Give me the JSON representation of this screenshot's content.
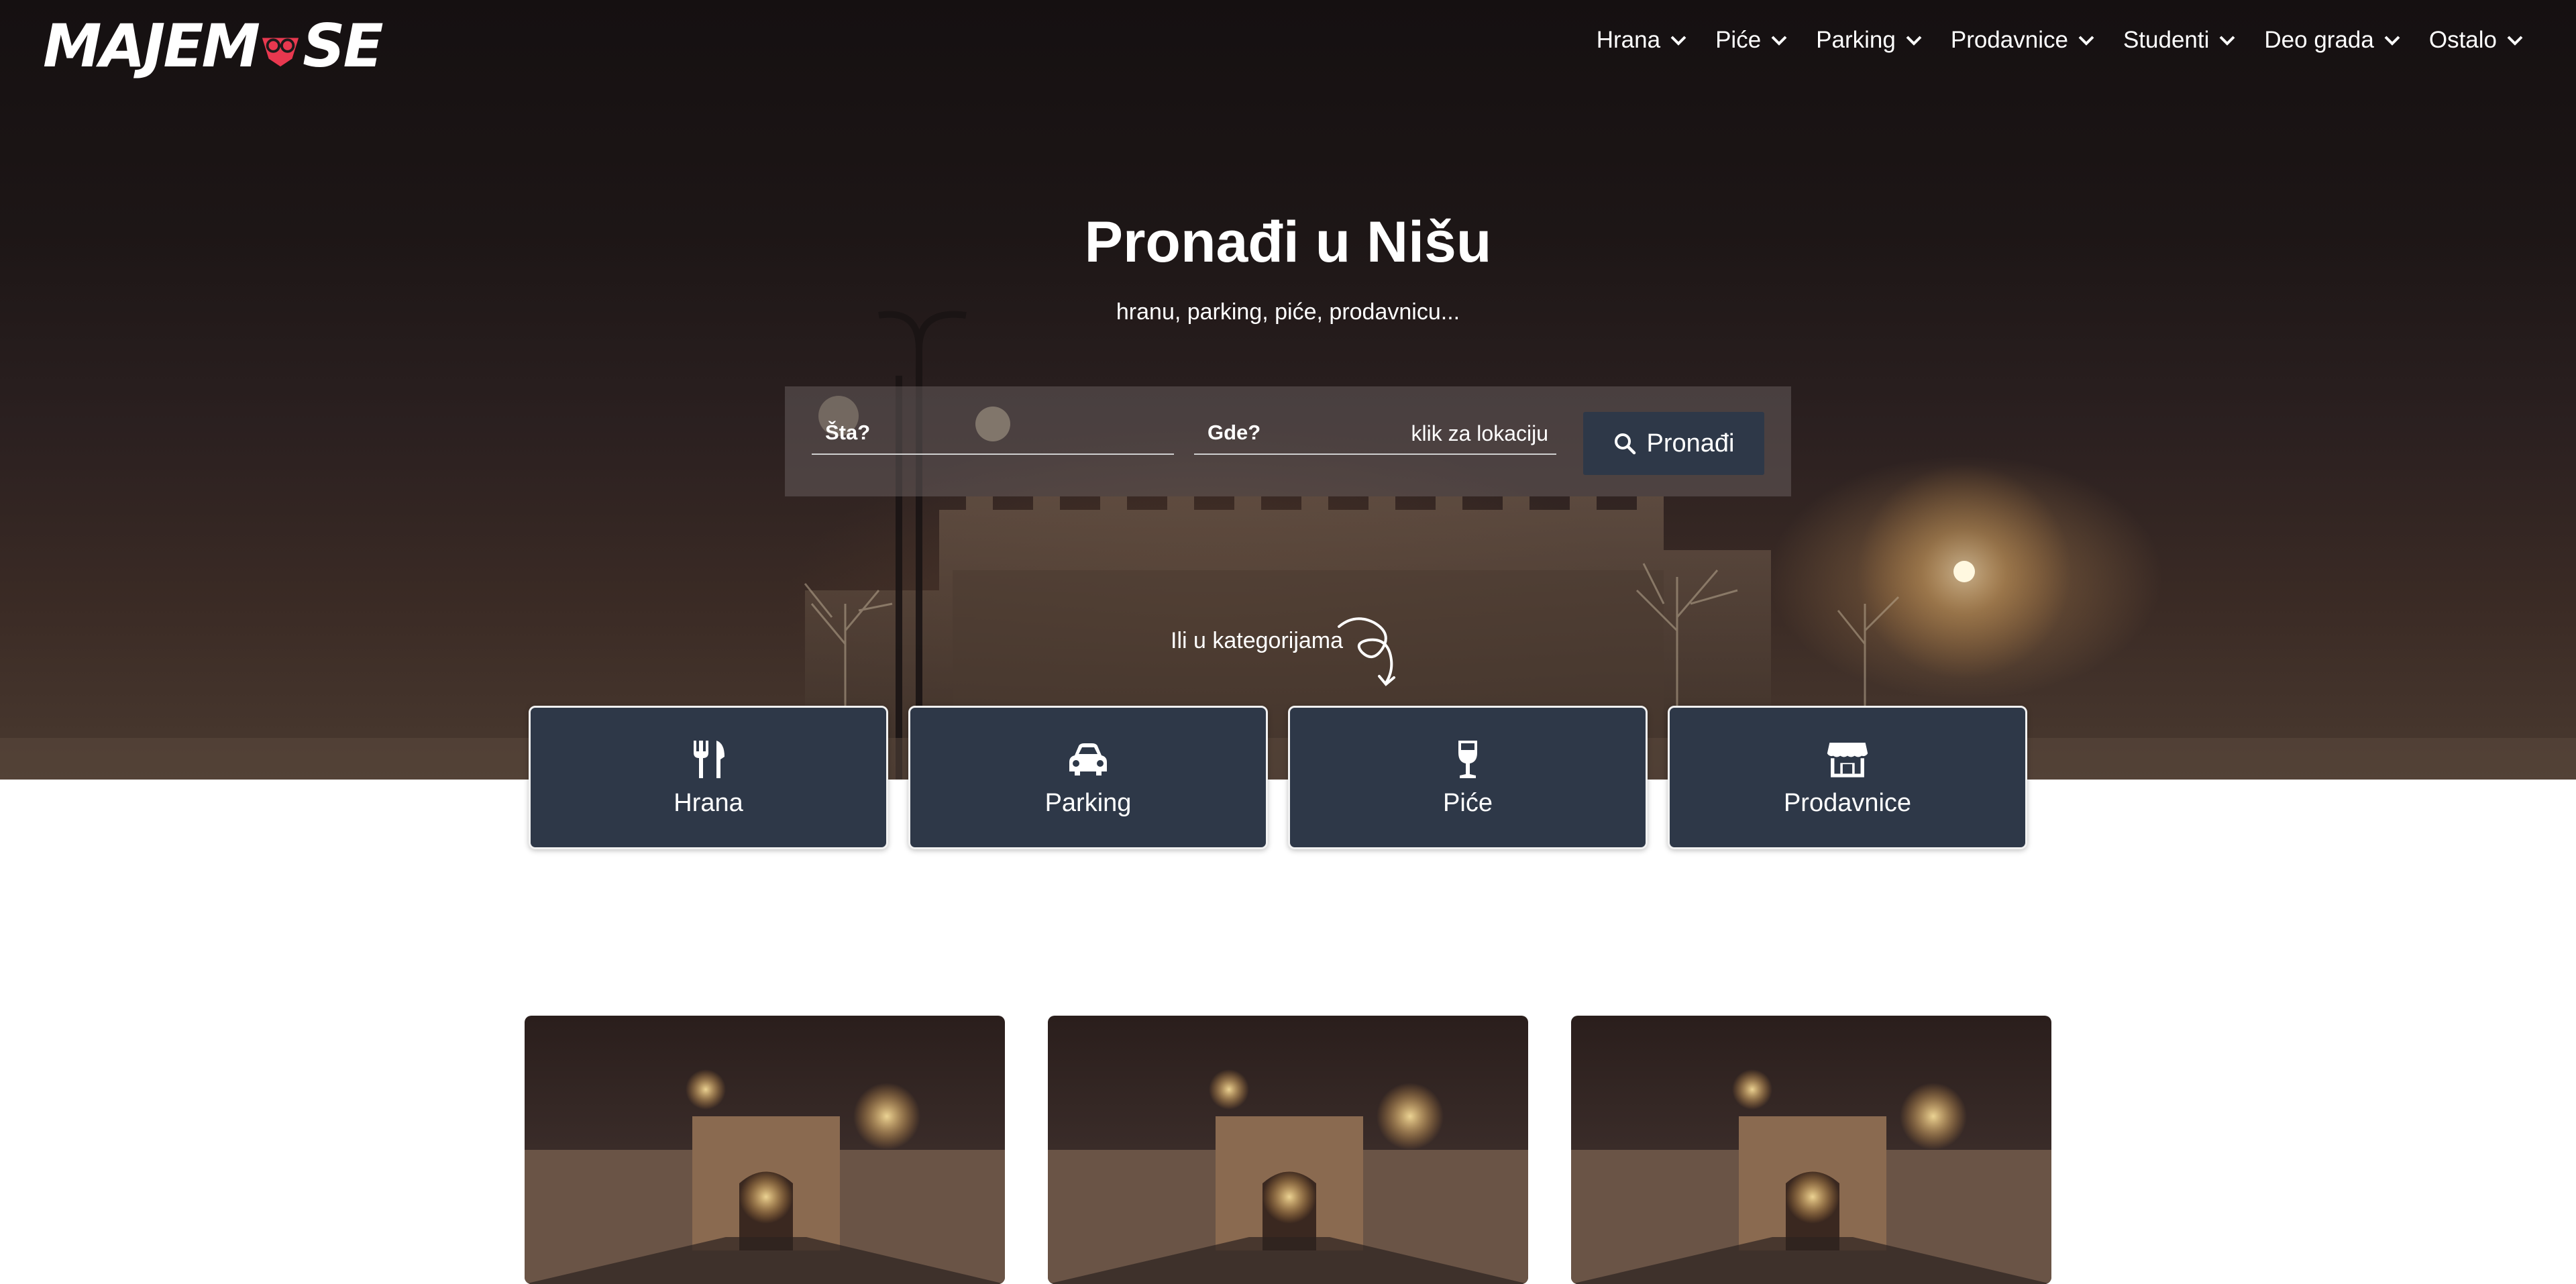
{
  "brand": {
    "logo_text_left": "MAJEM",
    "logo_text_right": "SE"
  },
  "nav": {
    "items": [
      {
        "label": "Hrana"
      },
      {
        "label": "Piće"
      },
      {
        "label": "Parking"
      },
      {
        "label": "Prodavnice"
      },
      {
        "label": "Studenti"
      },
      {
        "label": "Deo grada"
      },
      {
        "label": "Ostalo"
      }
    ]
  },
  "hero": {
    "title": "Pronađi u Nišu",
    "subtitle": "hranu, parking, piće, prodavnicu..."
  },
  "search": {
    "what_placeholder": "Šta?",
    "where_placeholder": "Gde?",
    "location_hint": "klik za lokaciju",
    "button_label": "Pronađi"
  },
  "categories": {
    "prompt": "Ili u kategorijama",
    "items": [
      {
        "label": "Hrana",
        "icon": "utensils-icon"
      },
      {
        "label": "Parking",
        "icon": "car-icon"
      },
      {
        "label": "Piće",
        "icon": "wine-glass-icon"
      },
      {
        "label": "Prodavnice",
        "icon": "store-icon"
      }
    ]
  },
  "colors": {
    "card_bg": "#2e3848",
    "text": "#ffffff",
    "logo_accent": "#e8384f"
  }
}
